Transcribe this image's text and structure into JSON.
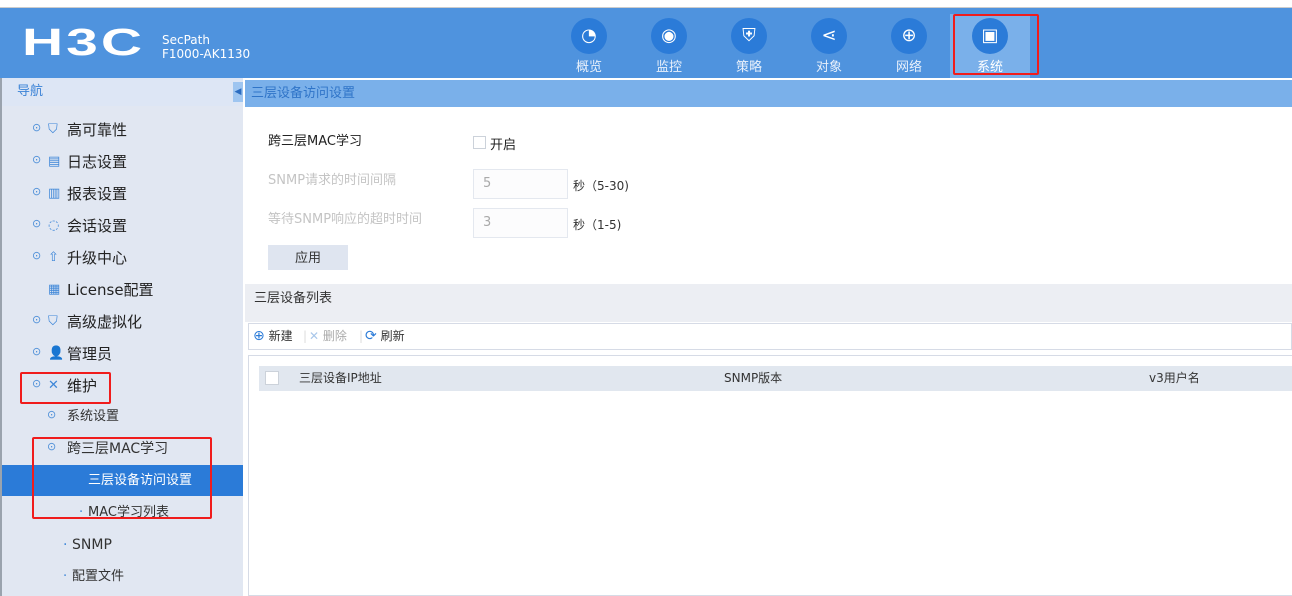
{
  "header": {
    "logo": "H3C",
    "product_line": "SecPath",
    "model": "F1000-AK1130",
    "tabs": [
      {
        "label": "概览",
        "icon": "gauge-icon"
      },
      {
        "label": "监控",
        "icon": "camera-icon"
      },
      {
        "label": "策略",
        "icon": "shield-plus-icon"
      },
      {
        "label": "对象",
        "icon": "share-icon"
      },
      {
        "label": "网络",
        "icon": "globe-icon"
      },
      {
        "label": "系统",
        "icon": "monitor-gear-icon",
        "selected": true
      }
    ]
  },
  "sidebar": {
    "title": "导航",
    "items": [
      {
        "label": "高可靠性"
      },
      {
        "label": "日志设置"
      },
      {
        "label": "报表设置"
      },
      {
        "label": "会话设置"
      },
      {
        "label": "升级中心"
      },
      {
        "label": "License配置"
      },
      {
        "label": "高级虚拟化"
      },
      {
        "label": "管理员"
      },
      {
        "label": "维护",
        "expanded": true
      }
    ],
    "sub_items": [
      {
        "label": "系统设置"
      },
      {
        "label": "跨三层MAC学习",
        "expanded": true
      },
      {
        "label": "三层设备访问设置",
        "selected": true
      },
      {
        "label": "MAC学习列表"
      },
      {
        "label": "SNMP"
      },
      {
        "label": "配置文件"
      }
    ]
  },
  "main": {
    "title": "三层设备访问设置",
    "form": {
      "mac_learning_label": "跨三层MAC学习",
      "enable_label": "开启",
      "enable_checked": false,
      "interval_label": "SNMP请求的时间间隔",
      "interval_value": "5",
      "interval_unit": "秒（5-30)",
      "timeout_label": "等待SNMP响应的超时时间",
      "timeout_value": "3",
      "timeout_unit": "秒（1-5)",
      "apply_label": "应用"
    },
    "list_title": "三层设备列表",
    "toolbar": {
      "new": "新建",
      "delete": "删除",
      "refresh": "刷新"
    },
    "table": {
      "columns": [
        "三层设备IP地址",
        "SNMP版本",
        "v3用户名"
      ],
      "rows": []
    }
  },
  "colors": {
    "header": "#4f93de",
    "accent": "#2b7bd8",
    "highlight": "#f01c1c"
  }
}
